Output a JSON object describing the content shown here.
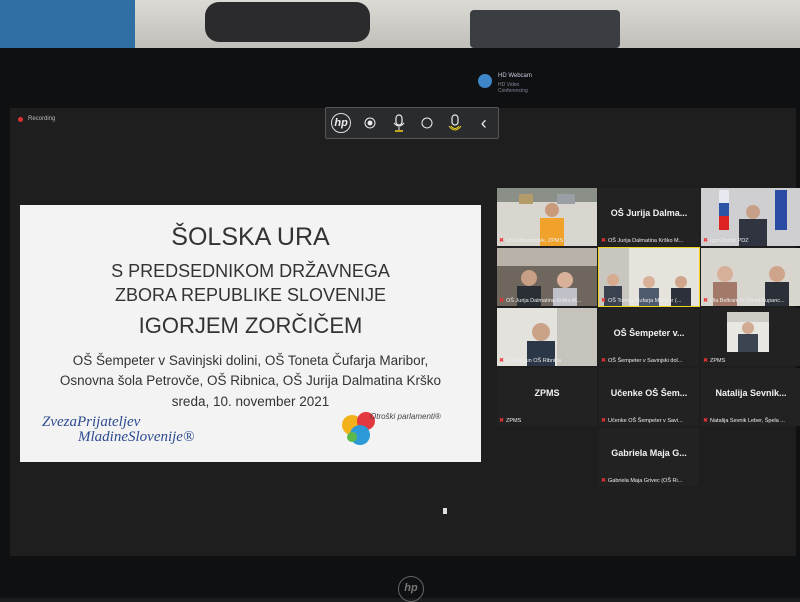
{
  "recording_label": "Recording",
  "webcam": {
    "name": "HD Webcam",
    "sub": "HD Video Conferencing"
  },
  "toolbar": {
    "logo": "hp",
    "back": "‹"
  },
  "slide": {
    "title1": "ŠOLSKA URA",
    "title2": "S PREDSEDNIKOM DRŽAVNEGA",
    "title3": "ZBORA REPUBLIKE SLOVENIJE",
    "title4": "IGORJEM ZORČIČEM",
    "line1": "OŠ Šempeter v Savinjski dolini, OŠ Toneta Čufarja Maribor,",
    "line2": "Osnovna šola Petrovče, OŠ Ribnica, OŠ Jurija Dalmatina Krško",
    "line3": "sreda, 10. november 2021",
    "logo_left_1": "ZvezaPrijateljev",
    "logo_left_2": "MladineSlovenije®",
    "logo_right": "Otroški parlamenti®"
  },
  "participants": [
    {
      "big": "",
      "caption": "Uroš Brezovšek, ZPMS"
    },
    {
      "big": "OŠ Jurija Dalma...",
      "caption": "OŠ Jurija Dalmatina Krško M..."
    },
    {
      "big": "",
      "caption": "Igor Zorčič PDZ"
    },
    {
      "big": "",
      "caption": "OŠ Jurija Dalmatina Krško M..."
    },
    {
      "big": "",
      "caption": "OŠ Toneta Čufarja Maribor (..."
    },
    {
      "big": "",
      "caption": "Ula Beltram in David Zupanc..."
    },
    {
      "big": "",
      "caption": "Luka Kljun OŠ Ribnica"
    },
    {
      "big": "OŠ Šempeter v...",
      "caption": "OŠ Šempeter v Savinjski dol..."
    },
    {
      "big": "",
      "caption": "ZPMS"
    },
    {
      "big": "ZPMS",
      "caption": "ZPMS"
    },
    {
      "big": "Učenke OŠ Šem...",
      "caption": "Učenke OŠ Šempeter v Savi..."
    },
    {
      "big": "Natalija Sevnik...",
      "caption": "Natalija Sevnik Leber, Špela ..."
    },
    {
      "big": "Gabriela Maja G...",
      "caption": "Gabriela Maja Grivec (OŠ Ri..."
    }
  ],
  "colors": {
    "slide_bg": "#f3f3f3",
    "tile_bg": "#222222",
    "active_border": "#f2d31c",
    "muted_mic": "#e33333"
  }
}
